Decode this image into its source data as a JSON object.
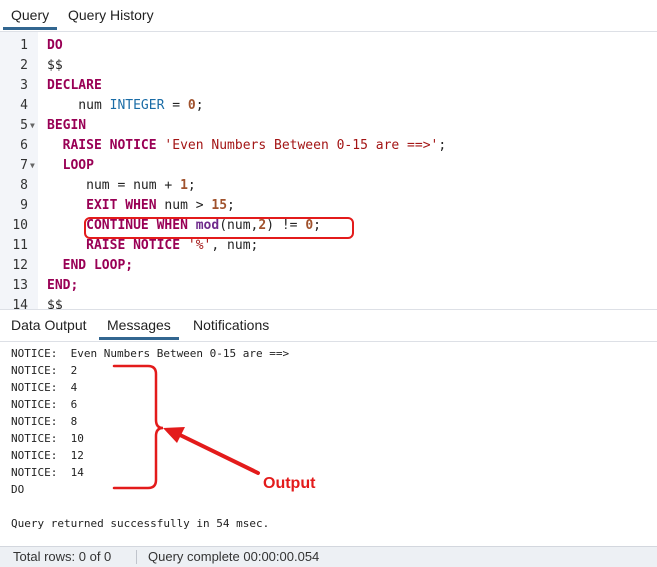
{
  "top_tabs": [
    {
      "label": "Query"
    },
    {
      "label": "Query History"
    }
  ],
  "bottom_tabs": [
    {
      "label": "Data Output"
    },
    {
      "label": "Messages"
    },
    {
      "label": "Notifications"
    }
  ],
  "code_lines": [
    {
      "n": "1",
      "t": "DO"
    },
    {
      "n": "2",
      "t": "$$"
    },
    {
      "n": "3",
      "t": "DECLARE"
    },
    {
      "n": "4",
      "t": "    num INTEGER = 0;"
    },
    {
      "n": "5",
      "t": "BEGIN"
    },
    {
      "n": "6",
      "t": "  RAISE NOTICE 'Even Numbers Between 0-15 are ==>';"
    },
    {
      "n": "7",
      "t": "  LOOP"
    },
    {
      "n": "8",
      "t": "     num = num + 1;"
    },
    {
      "n": "9",
      "t": "     EXIT WHEN num > 15;"
    },
    {
      "n": "10",
      "t": "     CONTINUE WHEN mod(num,2) != 0;"
    },
    {
      "n": "11",
      "t": "     RAISE NOTICE '%', num;"
    },
    {
      "n": "12",
      "t": "  END LOOP;"
    },
    {
      "n": "13",
      "t": "END;"
    },
    {
      "n": "14",
      "t": "$$"
    }
  ],
  "messages": [
    "NOTICE:  Even Numbers Between 0-15 are ==>",
    "NOTICE:  2",
    "NOTICE:  4",
    "NOTICE:  6",
    "NOTICE:  8",
    "NOTICE:  10",
    "NOTICE:  12",
    "NOTICE:  14",
    "DO",
    "",
    "Query returned successfully in 54 msec."
  ],
  "annotation": {
    "label": "Output"
  },
  "status": {
    "total_rows": "Total rows: 0 of 0",
    "query_complete": "Query complete 00:00:00.054"
  },
  "colors": {
    "accent": "#326690",
    "annotation": "#e31b1b"
  }
}
